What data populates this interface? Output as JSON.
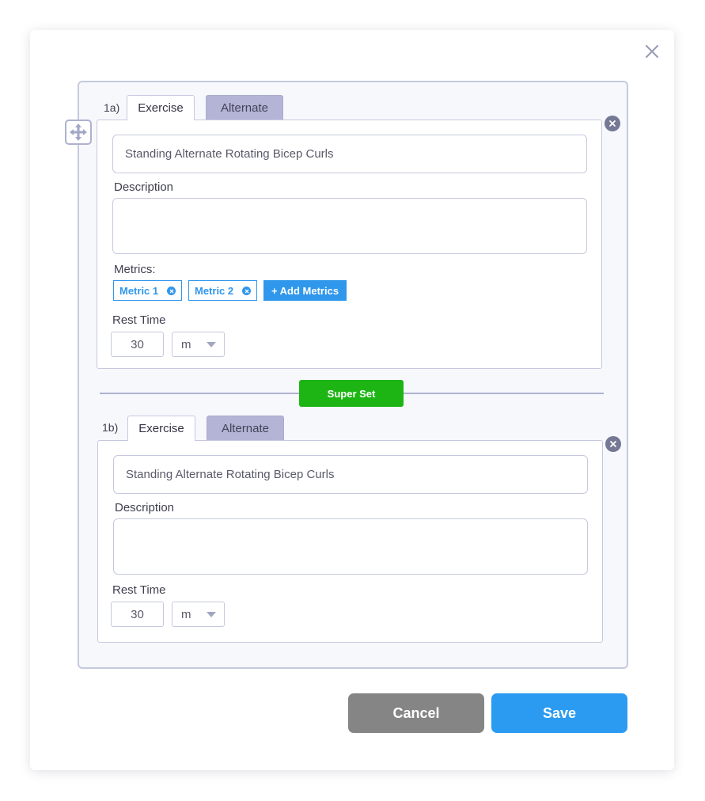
{
  "exercises": [
    {
      "label": "1a)",
      "tabs": {
        "exercise": "Exercise",
        "alternate": "Alternate"
      },
      "name_value": "Standing Alternate Rotating Bicep Curls",
      "description_label": "Description",
      "description_value": "",
      "metrics_label": "Metrics:",
      "metrics": [
        "Metric 1",
        "Metric 2"
      ],
      "add_metrics_label": "+ Add Metrics",
      "rest_time_label": "Rest Time",
      "rest_time_value": "30",
      "rest_time_unit": "m"
    },
    {
      "label": "1b)",
      "tabs": {
        "exercise": "Exercise",
        "alternate": "Alternate"
      },
      "name_value": "Standing Alternate Rotating Bicep Curls",
      "description_label": "Description",
      "description_value": "",
      "rest_time_label": "Rest Time",
      "rest_time_value": "30",
      "rest_time_unit": "m"
    }
  ],
  "superset_label": "Super Set",
  "footer": {
    "cancel_label": "Cancel",
    "save_label": "Save"
  },
  "icons": {
    "close": "close-icon",
    "drag": "move-icon",
    "remove": "remove-circle-icon",
    "chip_remove": "remove-circle-icon",
    "dropdown": "caret-down-icon"
  },
  "colors": {
    "primary": "#2b9bf1",
    "superset": "#1db514",
    "cancel": "#858585",
    "tab_inactive": "#b3b4d6",
    "border": "#c6c9de"
  }
}
